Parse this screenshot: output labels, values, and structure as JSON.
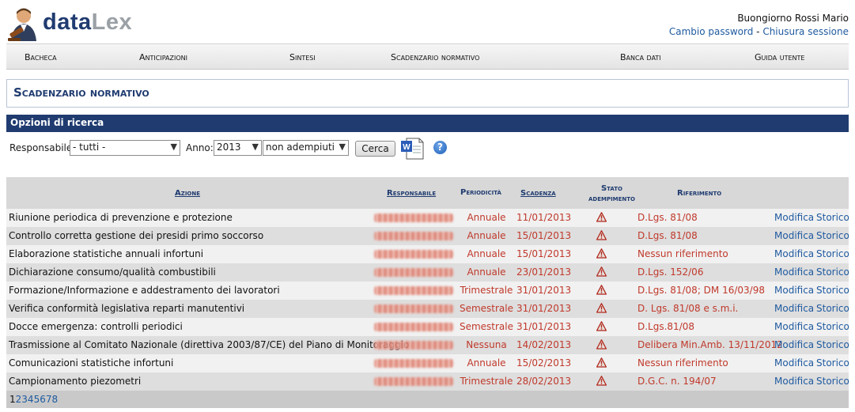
{
  "app": {
    "logo_left": "data",
    "logo_right": "Lex"
  },
  "user": {
    "greeting": "Buongiorno Rossi Mario",
    "change_password": "Cambio password",
    "separator": " - ",
    "logout": "Chiusura sessione"
  },
  "nav": [
    {
      "label": "Bacheca"
    },
    {
      "label": "Anticipazioni"
    },
    {
      "label": "Sintesi"
    },
    {
      "label": "Scadenzario normativo"
    },
    {
      "label": "Banca dati"
    },
    {
      "label": "Guida utente"
    }
  ],
  "page_title": "Scadenzario normativo",
  "search": {
    "section_title": "Opzioni di ricerca",
    "responsabile_label": "Responsabile:",
    "responsabile_value": "- tutti -",
    "anno_label": "Anno:",
    "anno_value": "2013",
    "stato_value": "non adempiuti",
    "button": "Cerca",
    "export_icon": "word-document-icon",
    "help_icon": "help-icon",
    "help_glyph": "?"
  },
  "table": {
    "headers": {
      "azione": "Azione",
      "responsabile": "Responsabile",
      "periodicita": "Periodicità",
      "scadenza": "Scadenza",
      "stato_line1": "Stato",
      "stato_line2": "adempimento",
      "riferimento": "Riferimento"
    },
    "status_icon": "warning-icon",
    "action_modify": "Modifica",
    "action_history": "Storico",
    "rows": [
      {
        "azione": "Riunione periodica di prevenzione e protezione",
        "periodicita": "Annuale",
        "scadenza": "11/01/2013",
        "riferimento": "D.Lgs. 81/08"
      },
      {
        "azione": "Controllo corretta gestione dei presidi primo soccorso",
        "periodicita": "Annuale",
        "scadenza": "15/01/2013",
        "riferimento": "D.Lgs. 81/08"
      },
      {
        "azione": "Elaborazione statistiche annuali infortuni",
        "periodicita": "Annuale",
        "scadenza": "15/01/2013",
        "riferimento": "Nessun riferimento"
      },
      {
        "azione": "Dichiarazione consumo/qualità combustibili",
        "periodicita": "Annuale",
        "scadenza": "23/01/2013",
        "riferimento": "D.Lgs. 152/06"
      },
      {
        "azione": "Formazione/Informazione e addestramento dei lavoratori",
        "periodicita": "Trimestrale",
        "scadenza": "31/01/2013",
        "riferimento": "D.Lgs. 81/08; DM 16/03/98"
      },
      {
        "azione": "Verifica conformità legislativa reparti manutentivi",
        "periodicita": "Semestrale",
        "scadenza": "31/01/2013",
        "riferimento": "D. Lgs. 81/08 e s.m.i."
      },
      {
        "azione": "Docce emergenza: controlli periodici",
        "periodicita": "Semestrale",
        "scadenza": "31/01/2013",
        "riferimento": "D.Lgs.81/08"
      },
      {
        "azione": "Trasmissione al Comitato Nazionale (direttiva 2003/87/CE) del Piano di Monitoraggio",
        "periodicita": "Nessuna",
        "scadenza": "14/02/2013",
        "riferimento": "Delibera Min.Amb. 13/11/2012"
      },
      {
        "azione": "Comunicazioni statistiche infortuni",
        "periodicita": "Annuale",
        "scadenza": "15/02/2013",
        "riferimento": "Nessun riferimento"
      },
      {
        "azione": "Campionamento piezometri",
        "periodicita": "Trimestrale",
        "scadenza": "28/02/2013",
        "riferimento": "D.G.C. n. 194/07"
      }
    ]
  },
  "pager": {
    "pages": [
      "1",
      "2",
      "3",
      "4",
      "5",
      "6",
      "7",
      "8"
    ],
    "current": "1"
  }
}
